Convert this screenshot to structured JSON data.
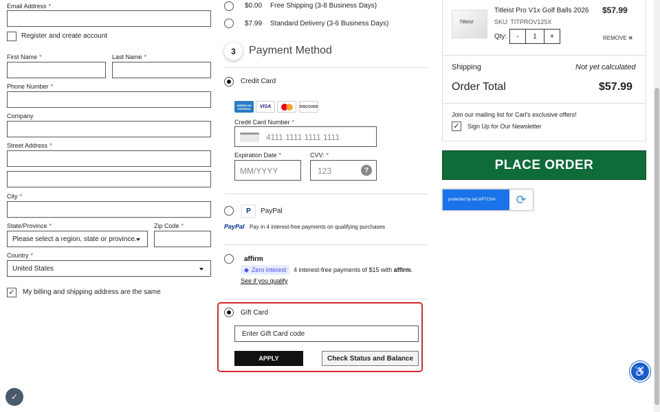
{
  "form": {
    "email_label": "Email Address",
    "register_label": "Register and create account",
    "first_name_label": "First Name",
    "last_name_label": "Last Name",
    "phone_label": "Phone Number",
    "company_label": "Company",
    "street_label": "Street Address",
    "city_label": "City",
    "state_label": "State/Province",
    "state_value": "Please select a region, state or province.",
    "zip_label": "Zip Code",
    "country_label": "Country",
    "country_value": "United States",
    "billing_same_label": "My billing and shipping address are the same",
    "required_mark": "*"
  },
  "shipping": {
    "options": [
      {
        "price": "$0.00",
        "label": "Free Shipping (3-8 Business Days)"
      },
      {
        "price": "$7.99",
        "label": "Standard Delivery (3-6 Business Days)"
      }
    ]
  },
  "payment": {
    "step_number": "3",
    "title": "Payment Method",
    "credit_card_label": "Credit Card",
    "card_logos": [
      "AMERICAN EXPRESS",
      "VISA",
      "MC",
      "DISCOVER"
    ],
    "card_number_label": "Credit Card Number",
    "card_number_placeholder": "4111 1111 1111 1111",
    "expiration_label": "Expiration Date",
    "expiration_placeholder": "MM/YYYY",
    "cvv_label": "CVV:",
    "cvv_placeholder": "123",
    "cvv_help": "?",
    "paypal_label": "PayPal",
    "paypal_brand": "PayPal",
    "paypal_desc": "Pay in 4 interest-free payments on qualifying purchases",
    "affirm_logo": "affirm",
    "affirm_badge": "Zero interest",
    "affirm_desc": "4 interest-free payments of $15 with",
    "affirm_brand": "affirm",
    "affirm_period": ".",
    "affirm_link": "See if you qualify",
    "gift_card_label": "Gift Card",
    "gift_card_placeholder": "Enter Gift Card code",
    "apply_label": "APPLY",
    "check_balance_label": "Check Status and Balance"
  },
  "summary": {
    "product_name": "Titleist Pro V1x Golf Balls 2026",
    "product_price": "$57.99",
    "sku": "SKU: TITPROV125X",
    "qty_label": "Qty:",
    "qty_minus": "-",
    "qty_value": "1",
    "qty_plus": "+",
    "remove_label": "REMOVE",
    "remove_x": "✕",
    "shipping_label": "Shipping",
    "shipping_value": "Not yet calculated",
    "total_label": "Order Total",
    "total_value": "$57.99",
    "mailing_text": "Join our mailing list for Carl's exclusive offers!",
    "newsletter_label": "Sign Up for Our Newsletter",
    "place_order_label": "PLACE ORDER",
    "recaptcha_text": "protected by reCAPTCHA"
  },
  "colors": {
    "place_order": "#0f6b3a",
    "highlight_border": "#d0282e",
    "accessibility": "#1b5fc1"
  }
}
